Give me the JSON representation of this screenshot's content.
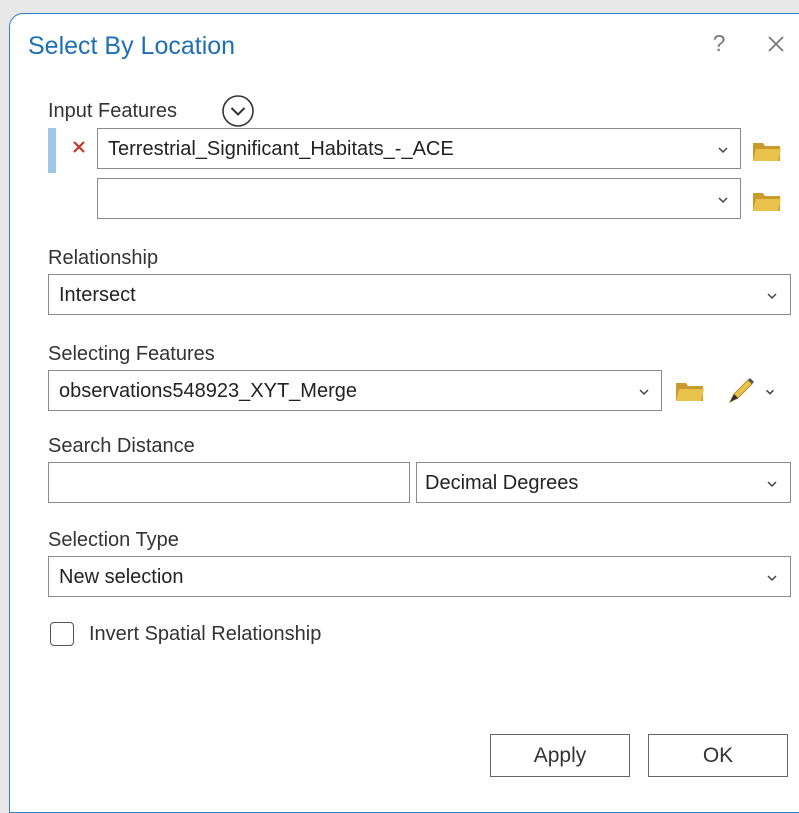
{
  "dialog": {
    "title": "Select By Location",
    "help_glyph": "?"
  },
  "input_features": {
    "label": "Input Features",
    "rows": [
      {
        "value": "Terrestrial_Significant_Habitats_-_ACE"
      },
      {
        "value": ""
      }
    ]
  },
  "relationship": {
    "label": "Relationship",
    "value": "Intersect"
  },
  "selecting_features": {
    "label": "Selecting Features",
    "value": "observations548923_XYT_Merge"
  },
  "search_distance": {
    "label": "Search Distance",
    "value": "",
    "unit": "Decimal Degrees"
  },
  "selection_type": {
    "label": "Selection Type",
    "value": "New selection"
  },
  "invert": {
    "label": "Invert Spatial Relationship",
    "checked": false
  },
  "buttons": {
    "apply": "Apply",
    "ok": "OK"
  },
  "colors": {
    "accent": "#1f6fb5",
    "folder": "#e2b93b",
    "remove": "#c0392b"
  },
  "icons": {
    "expand": "chevron-down-circle-icon",
    "remove": "close-icon",
    "browse": "folder-icon",
    "draw": "pencil-icon"
  }
}
